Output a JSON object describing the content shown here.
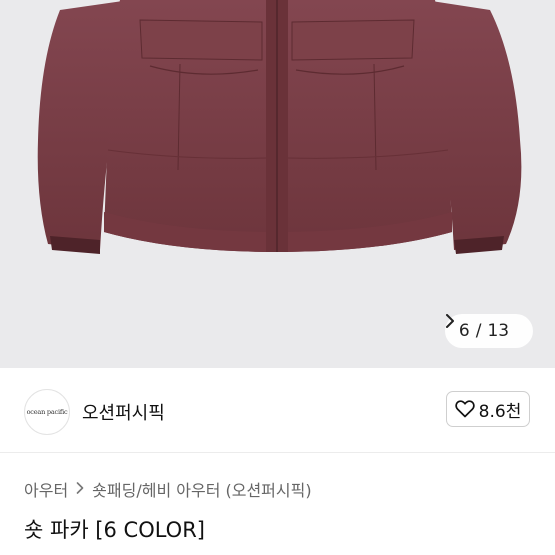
{
  "gallery": {
    "current": "6",
    "separator": "/",
    "total": "13",
    "next_icon": "chevron-right-icon",
    "jacket_color": "#7a3d44"
  },
  "brand": {
    "logo_text": "ocean pacific",
    "name": "오션퍼시픽",
    "like_icon": "heart-outline-icon",
    "like_count": "8.6천"
  },
  "breadcrumb": {
    "items": [
      "아우터",
      "숏패딩/헤비 아우터 (오션퍼시픽)"
    ]
  },
  "product": {
    "title": "숏 파카 [6 COLOR]"
  }
}
